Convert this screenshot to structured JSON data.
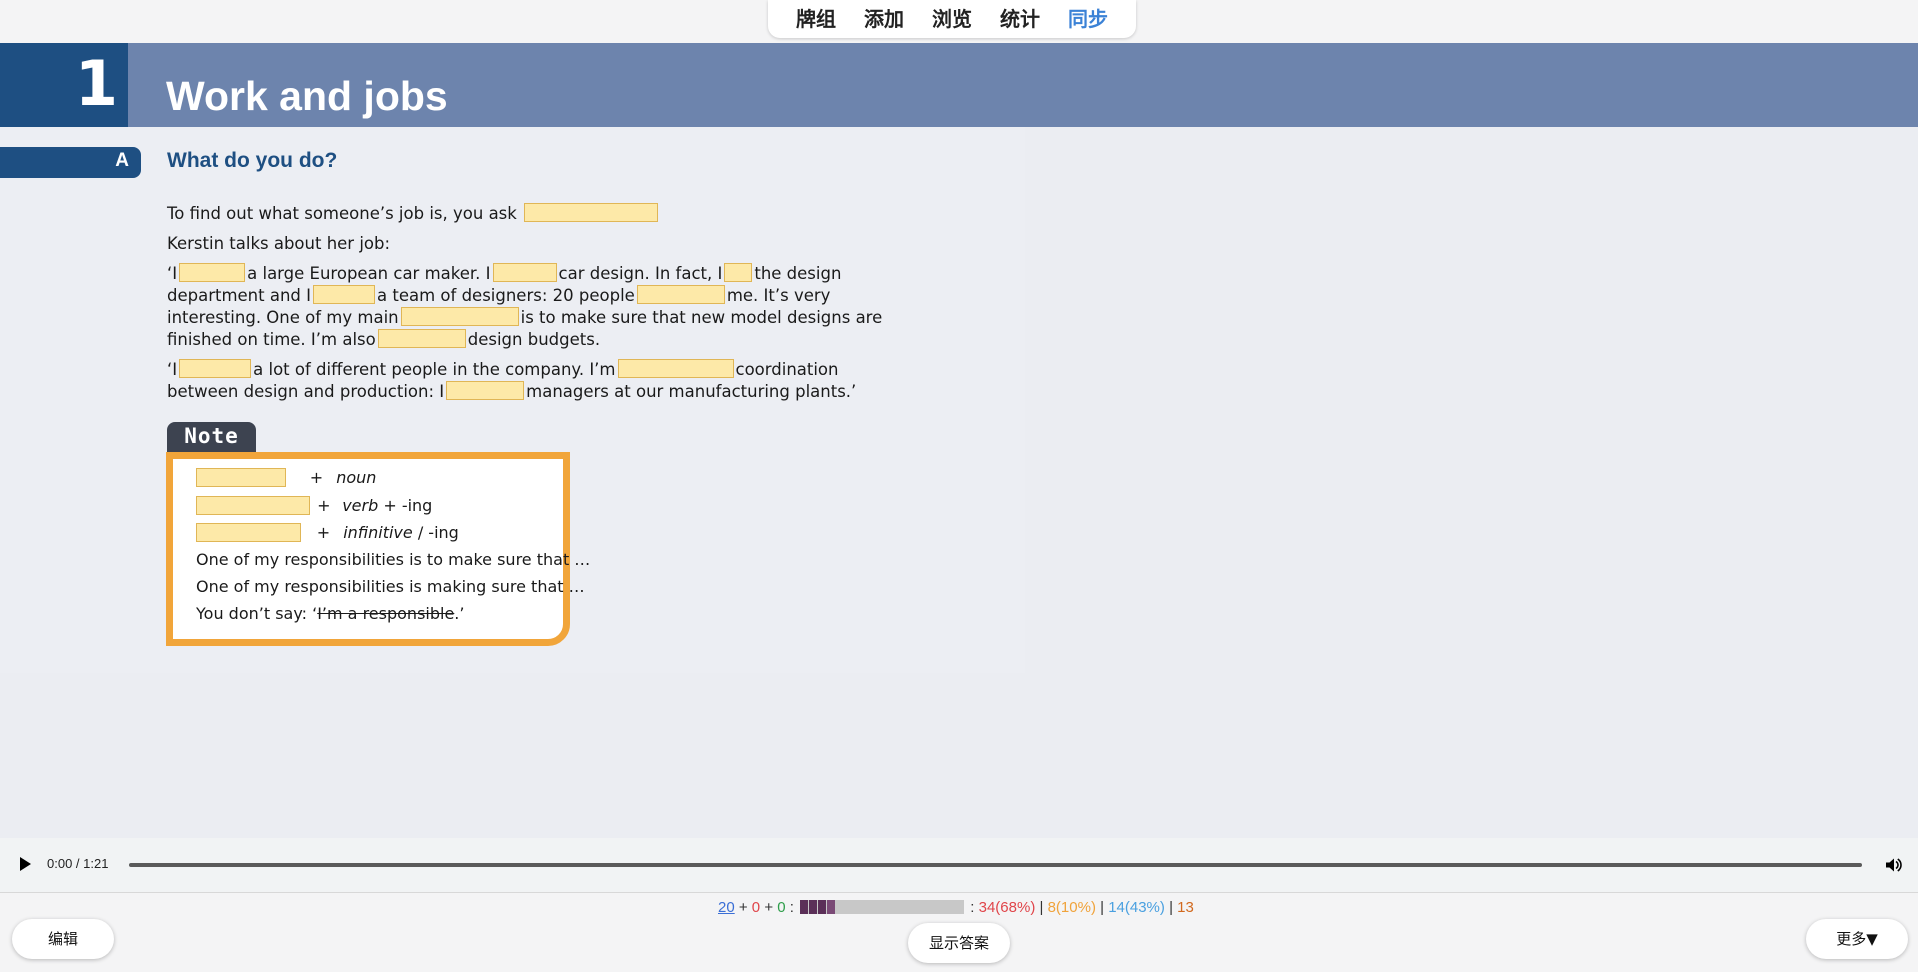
{
  "toolbar": {
    "tabs": [
      {
        "label": "牌组"
      },
      {
        "label": "添加"
      },
      {
        "label": "浏览"
      },
      {
        "label": "统计"
      },
      {
        "label": "同步"
      }
    ],
    "active_tab": "同步",
    "accent_color": "#3b82d6"
  },
  "card": {
    "unit_number": "1",
    "unit_title": "Work and jobs",
    "section_letter": "A",
    "section_title": "What do you do?",
    "intro_1": "To find out what someone’s job is, you ask",
    "intro_2": "Kerstin talks about her job:",
    "para1": {
      "l1a": "‘I",
      "l1b": "a large European car maker. I",
      "l1c": "car design. In fact, I",
      "l1d": "the design",
      "l2a": "department and I",
      "l2b": "a team of designers: 20 people",
      "l2c": "me. It’s very",
      "l3a": "interesting. One of my main",
      "l3b": "is to make sure that new model designs are",
      "l4a": "finished on time. I’m also",
      "l4b": "design budgets."
    },
    "para2": {
      "l1a": "‘I",
      "l1b": "a lot of different people in the company. I’m",
      "l1c": "coordination",
      "l2a": "between design and production: I",
      "l2b": "managers at our manufacturing plants.’"
    },
    "note": {
      "label": "Note",
      "r1_plus": "+",
      "r1_word": "noun",
      "r2_plus": "+",
      "r2_word": "verb",
      "r2_suffix": "+ -ing",
      "r3_plus": "+",
      "r3_word": "infinitive",
      "r3_suffix": "/ -ing",
      "line4": "One of my responsibilities is to make sure that …",
      "line5": "One of my responsibilities is making sure that …",
      "line6_pre": "You don’t say: ‘",
      "line6_strike": "I’m a responsible",
      "line6_post": ".’"
    },
    "blank_color": "#fde9a8"
  },
  "audio": {
    "time": "0:00 / 1:21",
    "progress": 0
  },
  "bottom": {
    "stats": {
      "due_new": "20",
      "plus_1": "+",
      "learning": "0",
      "plus_2": "+",
      "review": "0",
      "colon": ":",
      "colon2": ":",
      "again": "34(68%)",
      "sep1": "|",
      "hard": "8(10%)",
      "sep2": "|",
      "good": "14(43%)",
      "sep3": "|",
      "easy": "13"
    },
    "edit_label": "编辑",
    "show_answer_label": "显示答案",
    "more_label": "更多▼"
  }
}
